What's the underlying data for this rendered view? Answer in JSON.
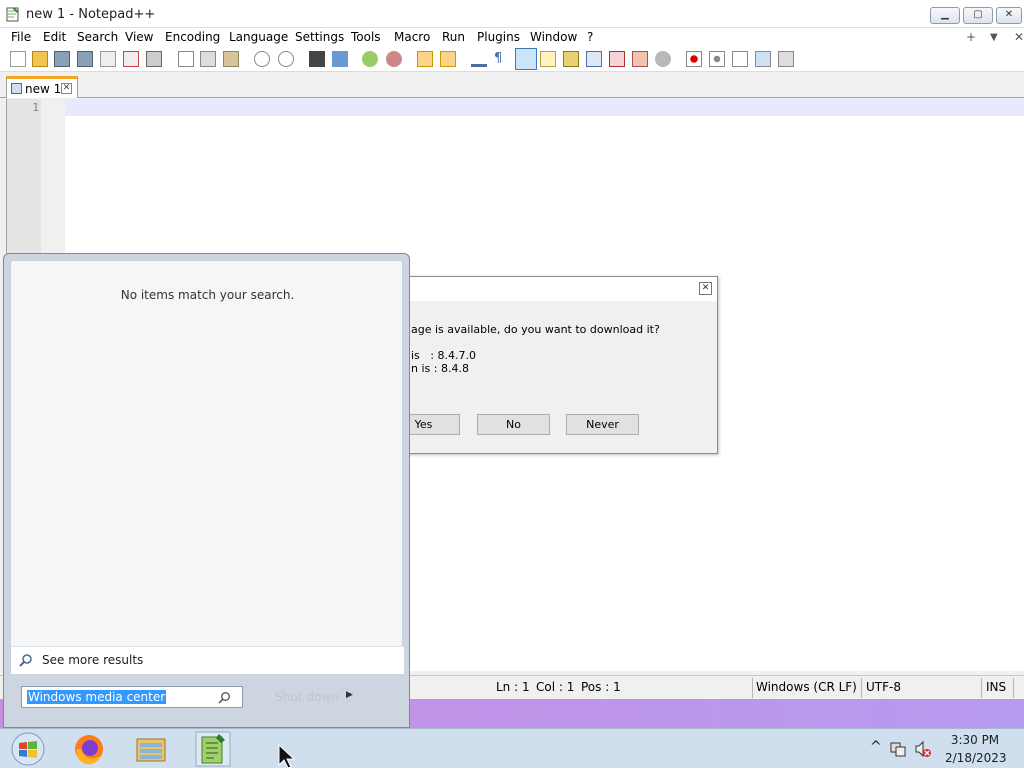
{
  "window": {
    "title": "new 1 - Notepad++",
    "min_icon": "minimize-icon",
    "max_icon": "maximize-icon",
    "close_icon": "close-icon",
    "close_glyph": "✕",
    "plus": "+",
    "dropdown": "▼",
    "x": "✕"
  },
  "menu": [
    "File",
    "Edit",
    "Search",
    "View",
    "Encoding",
    "Language",
    "Settings",
    "Tools",
    "Macro",
    "Run",
    "Plugins",
    "Window",
    "?"
  ],
  "tab": {
    "label": "new 1",
    "close": "✕"
  },
  "editor": {
    "line_number": "1"
  },
  "dialog": {
    "close": "✕",
    "message": "age is available, do you want to download it?",
    "current_line": "is   : 8.4.7.0",
    "new_line": "n is : 8.4.8",
    "yes": "Yes",
    "no": "No",
    "never": "Never"
  },
  "status": {
    "ln": "Ln : 1",
    "col": "Col : 1",
    "pos": "Pos : 1",
    "eol": "Windows (CR LF)",
    "encoding": "UTF-8",
    "mode": "INS"
  },
  "start_menu": {
    "no_items": "No items match your search.",
    "see_more": "See more results",
    "search_value": "Windows media center",
    "shutdown": "Shut down",
    "shutdown_arrow": "▶"
  },
  "taskbar": {
    "time": "3:30 PM",
    "date": "2/18/2023",
    "tray_arrow": "^"
  },
  "colors": {
    "accent_tab": "#f5a623",
    "purple_band": "#b69af0",
    "selection": "#3399ff",
    "taskbar": "#cfdfee"
  }
}
